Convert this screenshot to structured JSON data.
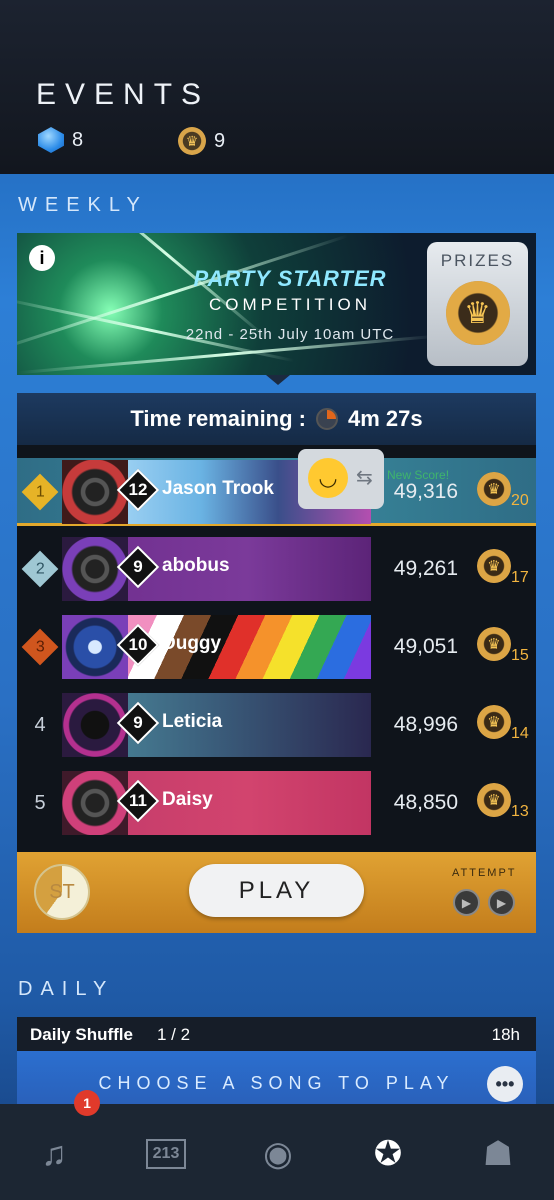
{
  "header": {
    "title": "EVENTS",
    "gems": "8",
    "trophies": "9"
  },
  "weekly": {
    "section_title": "WEEKLY",
    "banner": {
      "title": "PARTY STARTER",
      "subtitle": "COMPETITION",
      "dates": "22nd - 25th July 10am UTC",
      "prizes_label": "PRIZES"
    },
    "time_remaining_label": "Time remaining :",
    "time_remaining_value": "4m 27s",
    "new_score_label": "New Score!",
    "leaderboard": [
      {
        "rank": "1",
        "level": "12",
        "name": "Jason Trook",
        "score": "49,316",
        "points": "20"
      },
      {
        "rank": "2",
        "level": "9",
        "name": "abobus",
        "score": "49,261",
        "points": "17"
      },
      {
        "rank": "3",
        "level": "10",
        "name": "Duggy",
        "score": "49,051",
        "points": "15"
      },
      {
        "rank": "4",
        "level": "9",
        "name": "Leticia",
        "score": "48,996",
        "points": "14"
      },
      {
        "rank": "5",
        "level": "11",
        "name": "Daisy",
        "score": "48,850",
        "points": "13"
      }
    ],
    "st_label": "ST",
    "play_label": "PLAY",
    "attempt_label": "ATTEMPT"
  },
  "daily": {
    "section_title": "DAILY",
    "name": "Daily Shuffle",
    "count": "1 / 2",
    "time": "18h",
    "choose_label": "CHOOSE A SONG TO PLAY"
  },
  "tabbar": {
    "notification_count": "1",
    "items": [
      "music-add-icon",
      "leaderboard-podium-icon",
      "play-circle-icon",
      "events-ticket-icon",
      "friends-group-icon"
    ],
    "podium_labels": "213"
  },
  "colors": {
    "accent_gold": "#e3a82c",
    "background_blue": "#2d7fd6",
    "new_score_green": "#3fb56c"
  }
}
